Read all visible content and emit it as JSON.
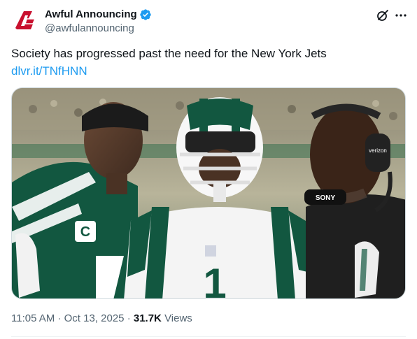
{
  "author": {
    "display_name": "Awful Announcing",
    "handle": "@awfulannouncing",
    "avatar_initials": "AA",
    "verified_color": "#1d9bf0",
    "brand_color": "#c8102e"
  },
  "header_icons": [
    "grok-icon",
    "more-icon"
  ],
  "tweet": {
    "text": "Society has progressed past the need for the New York Jets",
    "link": "dlvr.it/TNfHNN"
  },
  "media": {
    "alt": "",
    "jersey_captain_letter": "C",
    "jersey_number": "1",
    "headset_brand": "SONY",
    "headset_sticker": "verizon",
    "team_color": "#125740"
  },
  "meta": {
    "time": "11:05 AM",
    "separator": "·",
    "date": "Oct 13, 2025",
    "views_count": "31.7K",
    "views_label": "Views"
  }
}
